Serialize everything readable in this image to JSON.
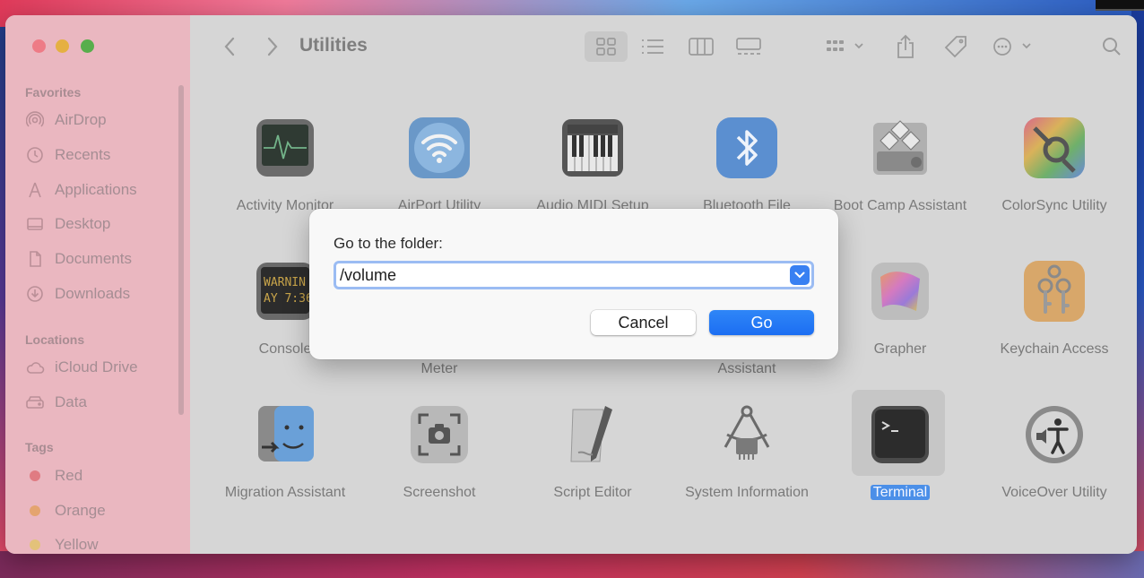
{
  "window": {
    "title": "Utilities"
  },
  "sidebar": {
    "sections": [
      {
        "title": "Favorites",
        "items": [
          {
            "label": "AirDrop",
            "icon": "airdrop-icon"
          },
          {
            "label": "Recents",
            "icon": "clock-icon"
          },
          {
            "label": "Applications",
            "icon": "applications-icon"
          },
          {
            "label": "Desktop",
            "icon": "desktop-icon"
          },
          {
            "label": "Documents",
            "icon": "document-icon"
          },
          {
            "label": "Downloads",
            "icon": "download-icon"
          }
        ]
      },
      {
        "title": "Locations",
        "items": [
          {
            "label": "iCloud Drive",
            "icon": "cloud-icon"
          },
          {
            "label": "Data",
            "icon": "drive-icon"
          }
        ]
      },
      {
        "title": "Tags",
        "items": [
          {
            "label": "Red",
            "color": "#e05a66"
          },
          {
            "label": "Orange",
            "color": "#e8a05a"
          },
          {
            "label": "Yellow",
            "color": "#e5c35a"
          }
        ]
      }
    ]
  },
  "toolbar": {
    "icons": [
      "back-icon",
      "forward-icon",
      "icon-view-icon",
      "list-view-icon",
      "column-view-icon",
      "gallery-view-icon",
      "group-icon",
      "share-icon",
      "tag-icon",
      "more-icon",
      "search-icon"
    ]
  },
  "apps": [
    {
      "label": "Activity Monitor",
      "icon": "activity-monitor-icon"
    },
    {
      "label": "AirPort Utility",
      "icon": "airport-utility-icon"
    },
    {
      "label": "Audio MIDI Setup",
      "icon": "audio-midi-setup-icon"
    },
    {
      "label": "Bluetooth File",
      "icon": "bluetooth-icon"
    },
    {
      "label": "Boot Camp Assistant",
      "icon": "boot-camp-icon"
    },
    {
      "label": "ColorSync Utility",
      "icon": "colorsync-icon"
    },
    {
      "label": "Console",
      "icon": "console-icon",
      "screen_text": "WARNIN\nAY 7:36"
    },
    {
      "label": "Meter",
      "icon": "meter-icon"
    },
    {
      "label": "Assistant",
      "icon": "assistant-icon"
    },
    {
      "label": "Grapher",
      "icon": "grapher-icon"
    },
    {
      "label": "Keychain Access",
      "icon": "keychain-icon"
    },
    {
      "label": "Migration Assistant",
      "icon": "migration-icon"
    },
    {
      "label": "Screenshot",
      "icon": "screenshot-icon"
    },
    {
      "label": "Script Editor",
      "icon": "script-editor-icon"
    },
    {
      "label": "System Information",
      "icon": "system-information-icon"
    },
    {
      "label": "Terminal",
      "icon": "terminal-icon",
      "selected": true
    },
    {
      "label": "VoiceOver Utility",
      "icon": "voiceover-icon"
    }
  ],
  "dialog": {
    "title": "Go to the folder:",
    "path_value": "/volume",
    "cancel_label": "Cancel",
    "go_label": "Go",
    "accent": "#1c6ef2"
  }
}
